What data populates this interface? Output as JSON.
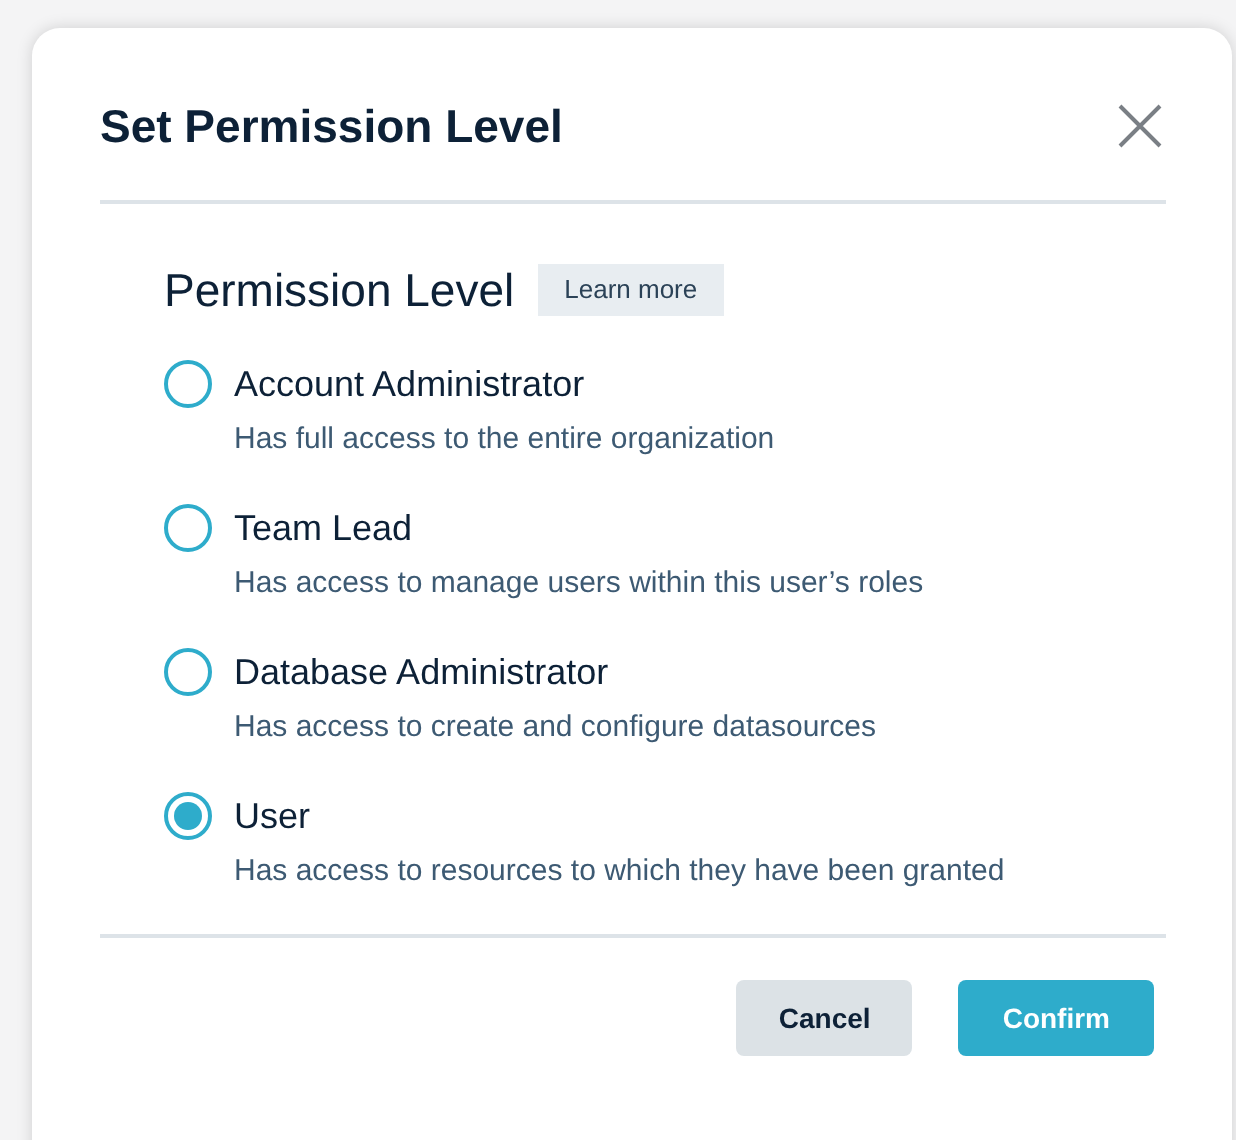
{
  "dialog": {
    "title": "Set Permission Level",
    "section_title": "Permission Level",
    "learn_more": "Learn more",
    "options": [
      {
        "label": "Account Administrator",
        "description": "Has full access to the entire organization",
        "selected": false
      },
      {
        "label": "Team Lead",
        "description": "Has access to manage users within this user’s roles",
        "selected": false
      },
      {
        "label": "Database Administrator",
        "description": "Has access to create and configure datasources",
        "selected": false
      },
      {
        "label": "User",
        "description": "Has access to resources to which they have been granted",
        "selected": true
      }
    ],
    "buttons": [
      {
        "label": "Cancel",
        "kind": "secondary"
      },
      {
        "label": "Confirm",
        "kind": "primary"
      }
    ]
  }
}
